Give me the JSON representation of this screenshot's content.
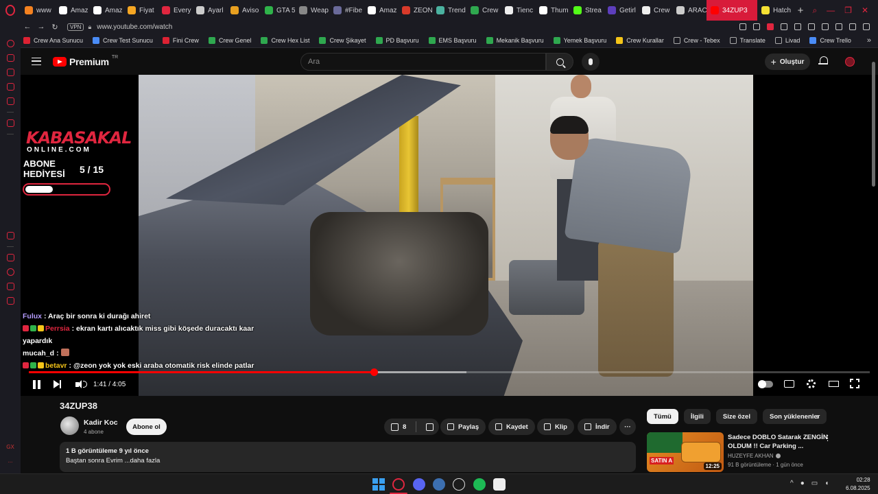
{
  "browser": {
    "tabs": [
      {
        "label": "www",
        "color": "#f58220"
      },
      {
        "label": "Amaz",
        "color": "#ffffff"
      },
      {
        "label": "Amaz",
        "color": "#ffffff"
      },
      {
        "label": "Fiyat",
        "color": "#f5a623"
      },
      {
        "label": "Every",
        "color": "#e0263f"
      },
      {
        "label": "Ayarl",
        "color": "#cccccc"
      },
      {
        "label": "Aviso",
        "color": "#e8a020"
      },
      {
        "label": "GTA 5",
        "color": "#2fb34a"
      },
      {
        "label": "Weap",
        "color": "#888888"
      },
      {
        "label": "#Fibe",
        "color": "#6a6a9a"
      },
      {
        "label": "Amaz",
        "color": "#ffffff"
      },
      {
        "label": "ZEON",
        "color": "#d83a2a"
      },
      {
        "label": "Trend",
        "color": "#4bb2a0"
      },
      {
        "label": "Crew",
        "color": "#2fa84f"
      },
      {
        "label": "Tienc",
        "color": "#eeeeee"
      },
      {
        "label": "Thum",
        "color": "#ffffff"
      },
      {
        "label": "Strea",
        "color": "#53fc18"
      },
      {
        "label": "Getirl",
        "color": "#5d3ebc"
      },
      {
        "label": "Crew",
        "color": "#eeeeee"
      },
      {
        "label": "ARAC",
        "color": "#cccccc"
      }
    ],
    "active_tab": {
      "label": "34ZUP3",
      "color": "#ff0000"
    },
    "after_tab": {
      "label": "Hatch",
      "color": "#f5e133"
    },
    "vpn_label": "VPN",
    "url": "www.youtube.com/watch"
  },
  "bookmarks": [
    {
      "label": "Crew Ana Sunucu",
      "kind": "red"
    },
    {
      "label": "Crew Test Sunucu",
      "kind": "blue"
    },
    {
      "label": "Fini Crew",
      "kind": "red"
    },
    {
      "label": "Crew Genel",
      "kind": "green"
    },
    {
      "label": "Crew Hex List",
      "kind": "green"
    },
    {
      "label": "Crew Şikayet",
      "kind": "green"
    },
    {
      "label": "PD Başvuru",
      "kind": "green"
    },
    {
      "label": "EMS Başvuru",
      "kind": "green"
    },
    {
      "label": "Mekanik Başvuru",
      "kind": "green"
    },
    {
      "label": "Yemek Başvuru",
      "kind": "green"
    },
    {
      "label": "Crew Kurallar",
      "kind": "yel"
    },
    {
      "label": "Crew - Tebex",
      "kind": "none"
    },
    {
      "label": "Translate",
      "kind": "none"
    },
    {
      "label": "Livad",
      "kind": "none"
    },
    {
      "label": "Crew Trello",
      "kind": "blue"
    }
  ],
  "youtube": {
    "brand": "Premium",
    "region": "TR",
    "search_placeholder": "Ara",
    "create_label": "Oluştur"
  },
  "overlay": {
    "logo": "KABASAKAL",
    "logo_sub": "ONLINE.COM",
    "gift_label": "ABONE HEDİYESİ",
    "gift_count": "5 / 15",
    "gift_progress": 0.33
  },
  "chat": [
    {
      "user": "Fulux",
      "user_color": "#b59cff",
      "text": "Araç bir sonra ki durağı ahiret",
      "badges": []
    },
    {
      "user": "Perrsia",
      "user_color": "#e0263f",
      "text": "ekran kartı alıcaktık miss gibi köşede duracaktı kaar yapardık",
      "badges": [
        "#e0263f",
        "#2fb34a",
        "#f5c518"
      ]
    },
    {
      "user": "mucah_d",
      "user_color": "#ffffff",
      "text": "",
      "badges": []
    },
    {
      "user": "betavr",
      "user_color": "#f5c518",
      "text": "@zeon yok yok eski araba otomatik risk elinde patlar",
      "badges": [
        "#e0263f",
        "#2fb34a",
        "#f5c518"
      ]
    }
  ],
  "player": {
    "time": "1:41 / 4:05",
    "progress": 0.41,
    "buffered": 0.52
  },
  "video": {
    "title": "34ZUP38",
    "channel": "Kadir Koc",
    "subscribers": "4 abone",
    "subscribe_label": "Abone ol",
    "likes": "8",
    "share_label": "Paylaş",
    "save_label": "Kaydet",
    "clip_label": "Klip",
    "download_label": "İndir",
    "views_date": "1 B görüntüleme  9 yıl önce",
    "description": "Baştan sonra Evrim ...daha fazla"
  },
  "chips": [
    "Tümü",
    "İlgili",
    "Size özel",
    "Son yüklenenler"
  ],
  "recommendation": {
    "title": "Sadece DOBLO Satarak ZENGİN OLDUM !! Car Parking ...",
    "channel": "HUZEYFE AKHAN",
    "meta": "91 B görüntüleme · 1 gün önce",
    "duration": "12:25",
    "thumb_text": "SATIN A"
  },
  "taskbar": {
    "time": "02:28",
    "date": "6.08.2025"
  },
  "sidebar": {
    "bottom_labels": [
      "GX",
      "..."
    ]
  }
}
